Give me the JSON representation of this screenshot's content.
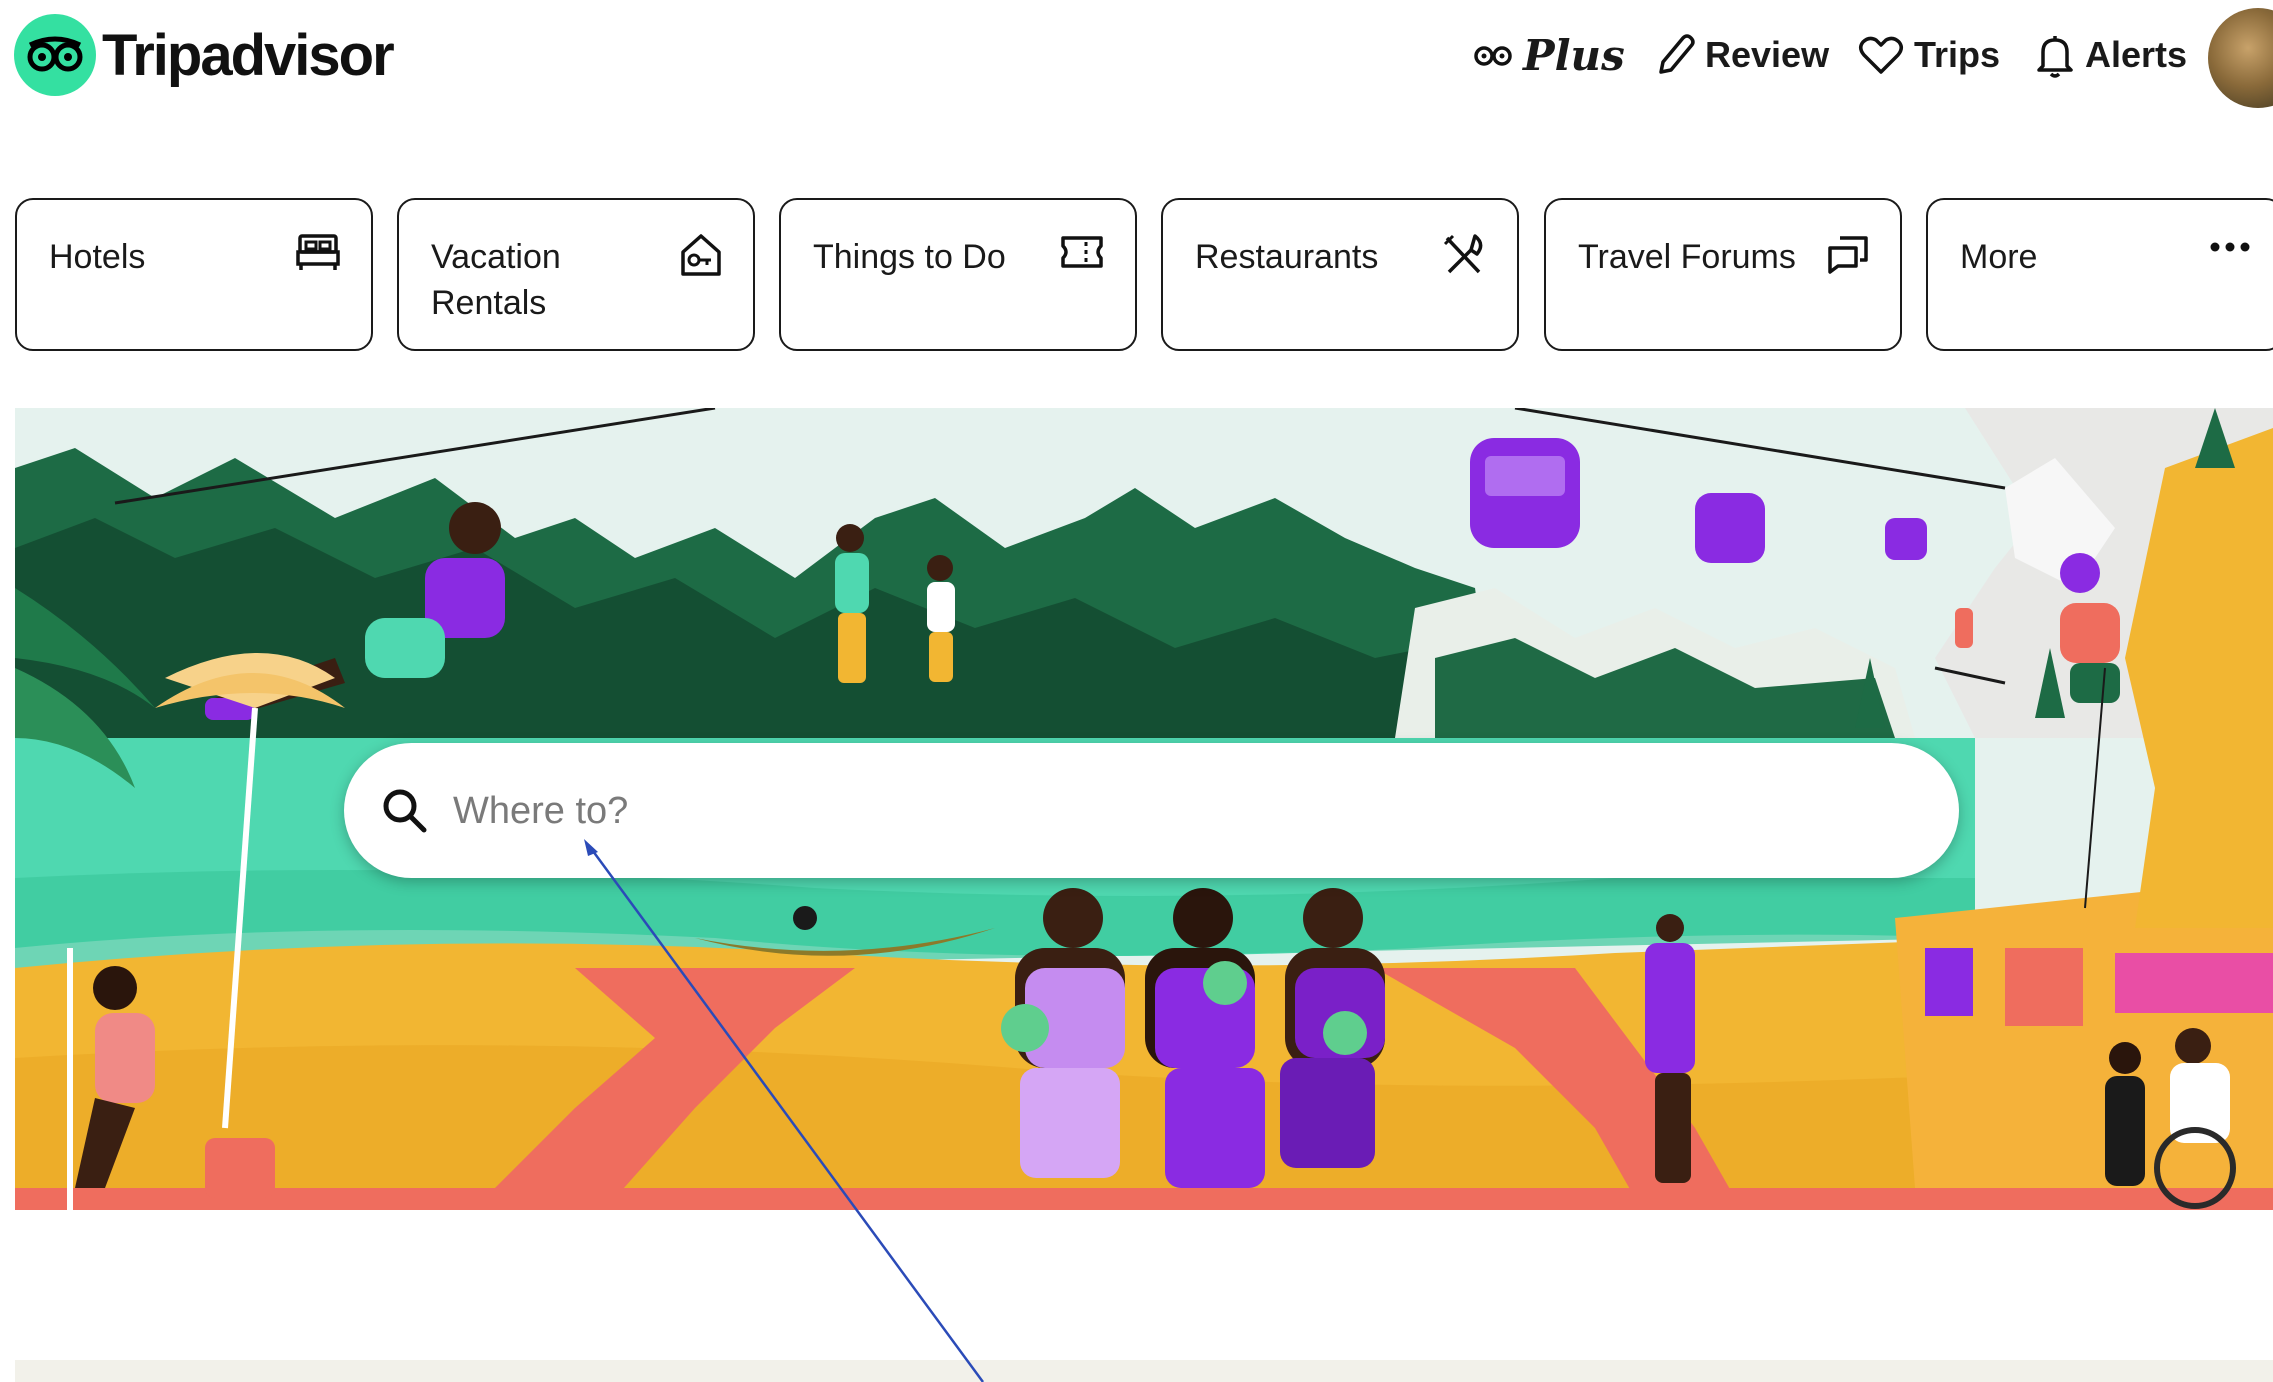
{
  "header": {
    "logo_text": "Tripadvisor",
    "nav": [
      {
        "label": "Plus",
        "icon": "owl-eyes-icon"
      },
      {
        "label": "Review",
        "icon": "pencil-icon"
      },
      {
        "label": "Trips",
        "icon": "heart-icon"
      },
      {
        "label": "Alerts",
        "icon": "bell-icon"
      }
    ]
  },
  "categories": [
    {
      "label": "Hotels",
      "icon": "bed-icon"
    },
    {
      "label": "Vacation Rentals",
      "icon": "house-key-icon"
    },
    {
      "label": "Things to Do",
      "icon": "ticket-icon"
    },
    {
      "label": "Restaurants",
      "icon": "fork-knife-icon"
    },
    {
      "label": "Travel Forums",
      "icon": "chat-bubbles-icon"
    },
    {
      "label": "More",
      "icon": "ellipsis-icon"
    }
  ],
  "search": {
    "placeholder": "Where to?",
    "value": ""
  },
  "colors": {
    "brand_green": "#34e0a1",
    "text": "#1a1a1a",
    "hero_sand": "#f2b632",
    "hero_mountain": "#1d6b45",
    "hero_purple": "#8a2be2"
  }
}
